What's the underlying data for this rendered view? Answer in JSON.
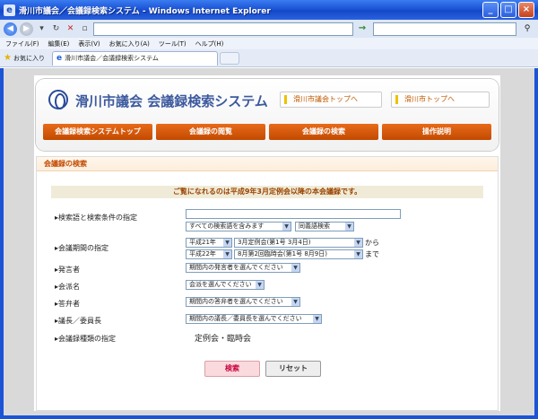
{
  "window": {
    "title": "滑川市議会／会議録検索システム - Windows Internet Explorer",
    "buttons": [
      "_",
      "□",
      "×"
    ]
  },
  "browser": {
    "url": "",
    "menu": [
      "ファイル(F)",
      "編集(E)",
      "表示(V)",
      "お気に入り(A)",
      "ツール(T)",
      "ヘルプ(H)"
    ],
    "favorites_label": "お気に入り",
    "tab_title": "滑川市議会／会議録検索システム"
  },
  "site": {
    "title": "滑川市議会 会議録検索システム",
    "top_links": [
      "滑川市議会トップへ",
      "滑川市トップへ"
    ],
    "nav": [
      "会議録検索システムトップ",
      "会議録の閲覧",
      "会議録の検索",
      "操作説明"
    ]
  },
  "search": {
    "section_title": "会議録の検索",
    "notice": "ご覧になれるのは平成9年3月定例会以降の本会議録です。",
    "fields": {
      "keyword": {
        "label": "検索語と検索条件の指定",
        "value": "",
        "condition": "すべての検索語を含みます",
        "mode": "同義語検索"
      },
      "period": {
        "label": "会議期間の指定",
        "from_year": "平成21年",
        "from_session": "3月定例会(第1号 3月4日)",
        "from_suffix": "から",
        "to_year": "平成22年",
        "to_session": "8月第2回臨時会(第1号 8月9日)",
        "to_suffix": "まで"
      },
      "speaker": {
        "label": "発言者",
        "value": "期間内の発言者を選んでください"
      },
      "faction": {
        "label": "会派名",
        "value": "会派を選んでください"
      },
      "respondent": {
        "label": "答弁者",
        "value": "期間内の答弁者を選んでください"
      },
      "chair": {
        "label": "議長／委員長",
        "value": "期間内の議長／委員長を選んでください"
      },
      "kind": {
        "label": "会議録種類の指定",
        "value": "定例会・臨時会"
      }
    },
    "buttons": {
      "search": "検索",
      "reset": "リセット"
    }
  },
  "colors": {
    "accent": "#d4550a",
    "titlebar": "#1c54d6",
    "brand": "#3d5a9e"
  }
}
